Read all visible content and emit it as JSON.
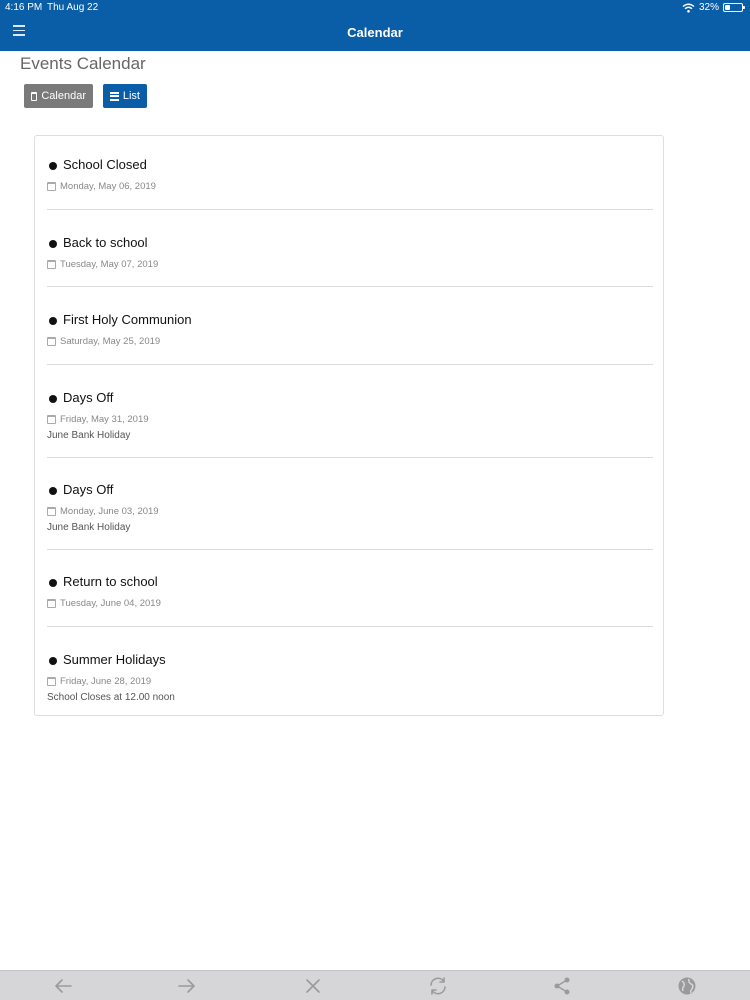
{
  "status_bar": {
    "time": "4:16 PM",
    "date": "Thu Aug 22",
    "battery": "32%"
  },
  "nav": {
    "title": "Calendar",
    "menu_icon": "hamburger-menu-icon"
  },
  "page": {
    "title": "Events Calendar"
  },
  "view_toggle": {
    "calendar_label": "Calendar",
    "list_label": "List",
    "active": "List"
  },
  "events": [
    {
      "title": "School Closed",
      "date": "Monday, May 06, 2019",
      "description": ""
    },
    {
      "title": "Back to school",
      "date": "Tuesday, May 07, 2019",
      "description": ""
    },
    {
      "title": "First Holy Communion",
      "date": "Saturday, May 25, 2019",
      "description": ""
    },
    {
      "title": "Days Off",
      "date": "Friday, May 31, 2019",
      "description": "June Bank Holiday"
    },
    {
      "title": "Days Off",
      "date": "Monday, June 03, 2019",
      "description": "June Bank Holiday"
    },
    {
      "title": "Return to school",
      "date": "Tuesday, June 04, 2019",
      "description": ""
    },
    {
      "title": "Summer Holidays",
      "date": "Friday, June 28, 2019",
      "description": "School Closes at 12.00 noon"
    }
  ],
  "toolbar": {
    "icons": [
      "back-arrow-icon",
      "forward-arrow-icon",
      "close-icon",
      "refresh-icon",
      "share-icon",
      "globe-icon"
    ]
  },
  "colors": {
    "brand": "#0a5ea8",
    "calendar_button": "#7a7a7a",
    "toolbar": "#d6d6d8"
  }
}
